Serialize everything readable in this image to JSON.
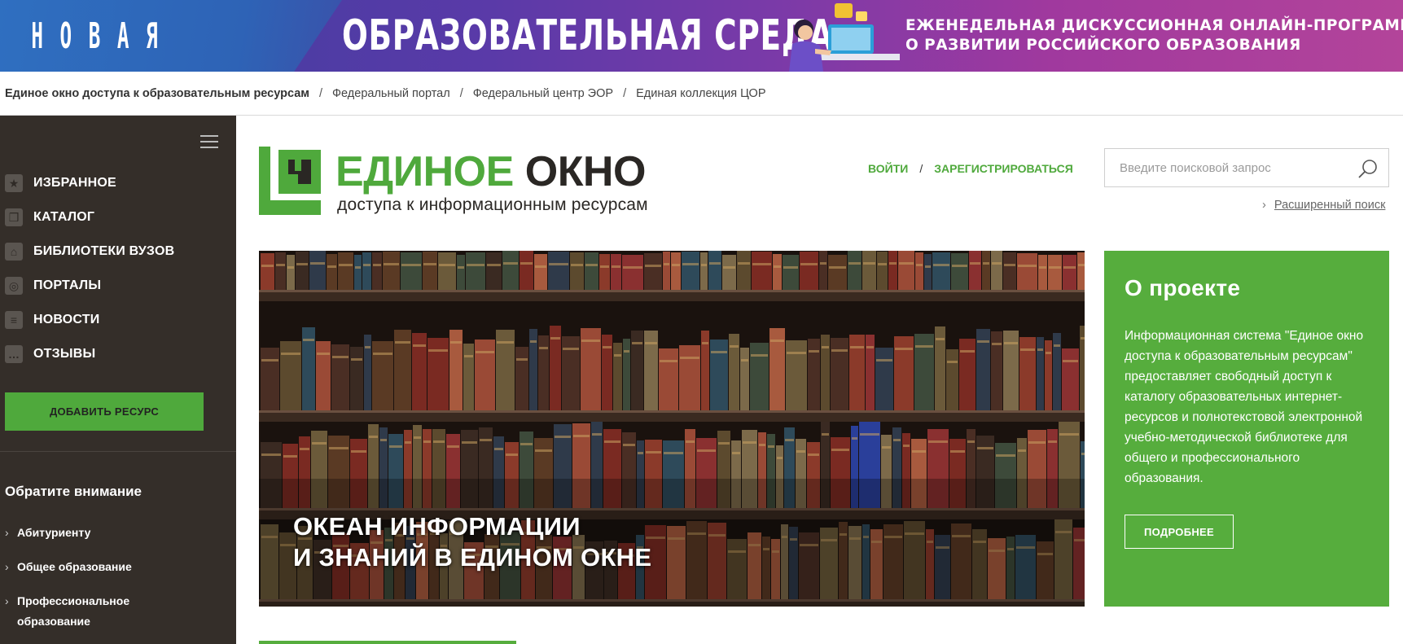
{
  "banner": {
    "word_letters": [
      "Н",
      "О",
      "В",
      "А",
      "Я"
    ],
    "title": "ОБРАЗОВАТЕЛЬНАЯ СРЕДА",
    "subtitle_line1": "ЕЖЕНЕДЕЛЬНАЯ  ДИСКУССИОННАЯ ОНЛАЙН-ПРОГРАММА",
    "subtitle_line2": "О РАЗВИТИИ РОССИЙСКОГО ОБРАЗОВАНИЯ"
  },
  "breadcrumb": {
    "items": [
      "Единое окно доступа к образовательным ресурсам",
      "Федеральный портал",
      "Федеральный центр ЭОР",
      "Единая коллекция ЦОР"
    ],
    "separator": "/"
  },
  "sidebar": {
    "items": [
      {
        "label": "ИЗБРАННОЕ",
        "icon": "star-icon",
        "glyph": "★"
      },
      {
        "label": "КАТАЛОГ",
        "icon": "catalog-icon",
        "glyph": "❒"
      },
      {
        "label": "БИБЛИОТЕКИ ВУЗОВ",
        "icon": "library-icon",
        "glyph": "⌂"
      },
      {
        "label": "ПОРТАЛЫ",
        "icon": "portal-icon",
        "glyph": "◎"
      },
      {
        "label": "НОВОСТИ",
        "icon": "news-icon",
        "glyph": "≡"
      },
      {
        "label": "ОТЗЫВЫ",
        "icon": "reviews-icon",
        "glyph": "…"
      }
    ],
    "add_button": "ДОБАВИТЬ РЕСУРС",
    "attention_title": "Обратите внимание",
    "attention_items": [
      "Абитуриенту",
      "Общее образование",
      "Профессиональное образование"
    ]
  },
  "logo": {
    "title_green": "ЕДИНОЕ",
    "title_dark": "ОКНО",
    "subtitle": "доступа к информационным ресурсам"
  },
  "auth": {
    "login": "ВОЙТИ",
    "separator": "/",
    "register": "ЗАРЕГИСТРИРОВАТЬСЯ"
  },
  "search": {
    "placeholder": "Введите поисковой запрос",
    "value": "",
    "advanced": "Расширенный поиск"
  },
  "hero": {
    "line1": "ОКЕАН ИНФОРМАЦИИ",
    "line2": "И ЗНАНИЙ В ЕДИНОМ ОКНЕ"
  },
  "about": {
    "title": "О проекте",
    "text": "Информационная система \"Единое окно доступа к образовательным ресурсам\" предоставляет свободный доступ к каталогу образовательных интернет-ресурсов и полнотекстовой электронной учебно-методической библиотеке для общего и профессионального образования.",
    "more_button": "ПОДРОБНЕЕ"
  },
  "colors": {
    "accent_green": "#4fa93c",
    "sidebar_bg": "#342e29",
    "about_bg": "#56ad3d"
  }
}
